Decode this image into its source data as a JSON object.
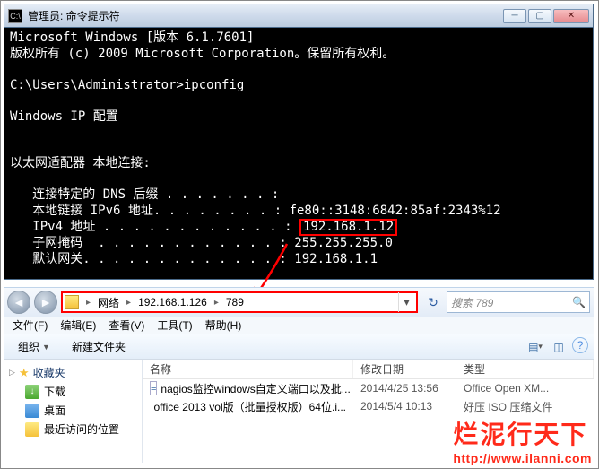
{
  "cmd": {
    "title": "管理员: 命令提示符",
    "icon_text": "C:\\",
    "lines": {
      "ver": "Microsoft Windows [版本 6.1.7601]",
      "copyright": "版权所有 (c) 2009 Microsoft Corporation。保留所有权利。",
      "prompt": "C:\\Users\\Administrator>ipconfig",
      "header": "Windows IP 配置",
      "adapter": "以太网适配器 本地连接:",
      "dns_label": "   连接特定的 DNS 后缀 . . . . . . . :",
      "ipv6_label": "   本地链接 IPv6 地址. . . . . . . . : ",
      "ipv6_value": "fe80::3148:6842:85af:2343%12",
      "ipv4_label": "   IPv4 地址 . . . . . . . . . . . . :",
      "ipv4_value": "192.168.1.12",
      "mask_label": "   子网掩码  . . . . . . . . . . . . : ",
      "mask_value": "255.255.255.0",
      "gw_label": "   默认网关. . . . . . . . . . . . . : ",
      "gw_value": "192.168.1.1"
    }
  },
  "explorer": {
    "breadcrumbs": [
      "网络",
      "192.168.1.126",
      "789"
    ],
    "search_placeholder": "搜索 789",
    "menu": [
      "文件(F)",
      "编辑(E)",
      "查看(V)",
      "工具(T)",
      "帮助(H)"
    ],
    "toolbar": {
      "organize": "组织",
      "newfolder": "新建文件夹"
    },
    "sidebar": {
      "favorites": "收藏夹",
      "items": [
        "下载",
        "桌面",
        "最近访问的位置"
      ]
    },
    "columns": {
      "name": "名称",
      "date": "修改日期",
      "type": "类型"
    },
    "files": [
      {
        "name": "nagios监控windows自定义端口以及批...",
        "date": "2014/4/25 13:56",
        "type": "Office Open XM..."
      },
      {
        "name": "office 2013 vol版（批量授权版）64位.i...",
        "date": "2014/5/4 10:13",
        "type": "好压 ISO 压缩文件"
      }
    ]
  },
  "watermark": {
    "text": "烂泥行天下",
    "url": "http://www.ilanni.com"
  }
}
